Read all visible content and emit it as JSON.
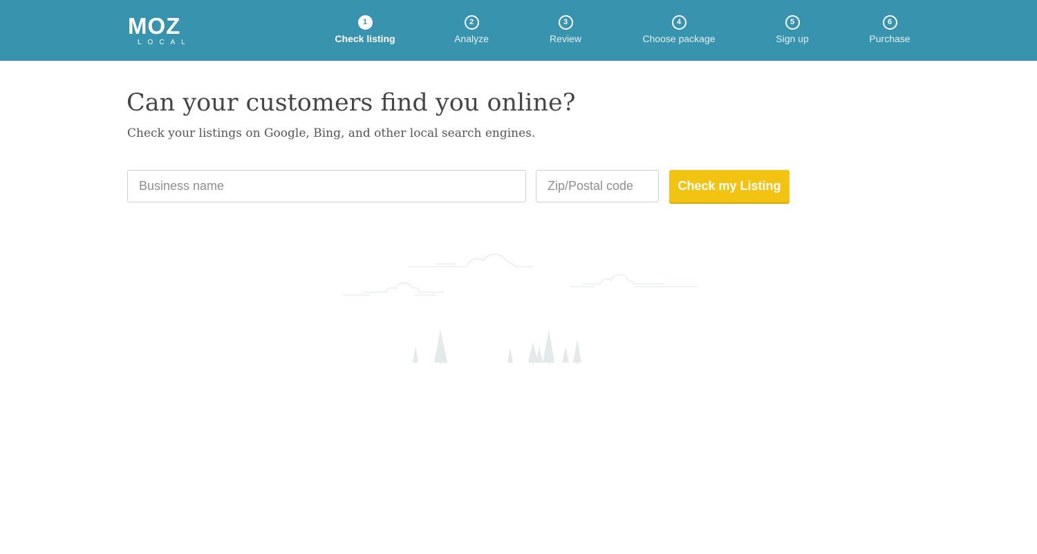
{
  "brand": {
    "name": "MOZ",
    "subtitle": "LOCAL"
  },
  "steps": [
    {
      "number": "1",
      "label": "Check listing",
      "active": true
    },
    {
      "number": "2",
      "label": "Analyze",
      "active": false
    },
    {
      "number": "3",
      "label": "Review",
      "active": false
    },
    {
      "number": "4",
      "label": "Choose package",
      "active": false
    },
    {
      "number": "5",
      "label": "Sign up",
      "active": false
    },
    {
      "number": "6",
      "label": "Purchase",
      "active": false
    }
  ],
  "main": {
    "headline": "Can your customers find you online?",
    "subheadline": "Check your listings on Google, Bing, and other local search engines."
  },
  "form": {
    "business_placeholder": "Business name",
    "business_value": "",
    "zip_placeholder": "Zip/Postal code",
    "zip_value": "",
    "submit_label": "Check my Listing"
  },
  "colors": {
    "header": "#3893ae",
    "cta": "#f3c312",
    "illustration": "#e4e9ea"
  },
  "icons": {
    "illustration": "clouds-and-trees-illustration"
  }
}
